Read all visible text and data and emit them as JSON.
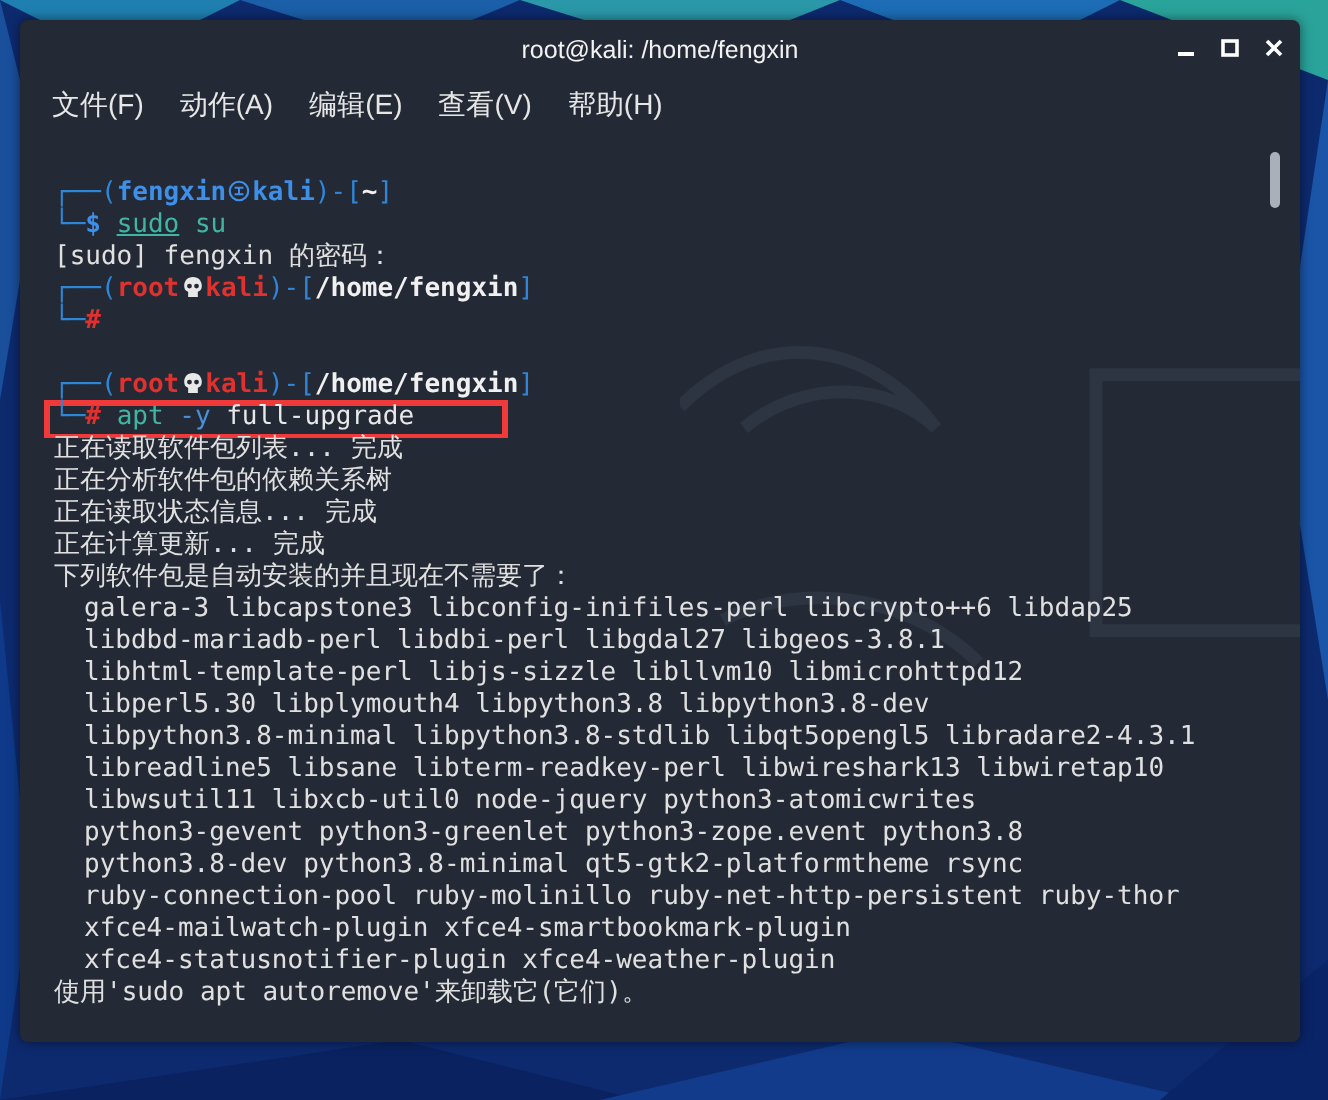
{
  "window": {
    "title": "root@kali: /home/fengxin"
  },
  "menu": [
    "文件(F)",
    "动作(A)",
    "编辑(E)",
    "查看(V)",
    "帮助(H)"
  ],
  "lines": [
    {
      "kind": "prompt",
      "root": false,
      "open": "┌──(",
      "user": "fengxin",
      "host": "kali",
      "middle": ")-[",
      "path": "~",
      "close": "]"
    },
    {
      "kind": "command",
      "root": false,
      "highlighted": false,
      "frame": "└─",
      "sigil": "$",
      "tokens": [
        {
          "kind": "precommand",
          "text": "sudo"
        },
        {
          "kind": "command",
          "text": "su"
        }
      ]
    },
    {
      "kind": "output",
      "text": "[sudo] fengxin 的密码："
    },
    {
      "kind": "prompt",
      "root": true,
      "open": "┌──(",
      "user": "root",
      "host": "kali",
      "middle": ")-[",
      "path": "/home/fengxin",
      "close": "]"
    },
    {
      "kind": "command",
      "root": true,
      "highlighted": false,
      "frame": "└─",
      "sigil": "#"
    },
    {
      "kind": "blank"
    },
    {
      "kind": "prompt",
      "root": true,
      "open": "┌──(",
      "user": "root",
      "host": "kali",
      "middle": ")-[",
      "path": "/home/fengxin",
      "close": "]"
    },
    {
      "kind": "command",
      "root": true,
      "highlighted": true,
      "frame": "└─",
      "sigil": "#",
      "tokens": [
        {
          "kind": "command",
          "text": "apt"
        },
        {
          "kind": "option",
          "text": "-y"
        },
        {
          "kind": "argument",
          "text": "full-upgrade"
        }
      ]
    },
    {
      "kind": "output",
      "text": "正在读取软件包列表... 完成"
    },
    {
      "kind": "output",
      "text": "正在分析软件包的依赖关系树"
    },
    {
      "kind": "output",
      "text": "正在读取状态信息... 完成"
    },
    {
      "kind": "output",
      "text": "正在计算更新... 完成"
    },
    {
      "kind": "output",
      "text": "下列软件包是自动安装的并且现在不需要了："
    },
    {
      "kind": "package",
      "text": "galera-3 libcapstone3 libconfig-inifiles-perl libcrypto++6 libdap25"
    },
    {
      "kind": "package",
      "text": "libdbd-mariadb-perl libdbi-perl libgdal27 libgeos-3.8.1"
    },
    {
      "kind": "package",
      "text": "libhtml-template-perl libjs-sizzle libllvm10 libmicrohttpd12"
    },
    {
      "kind": "package",
      "text": "libperl5.30 libplymouth4 libpython3.8 libpython3.8-dev"
    },
    {
      "kind": "package",
      "text": "libpython3.8-minimal libpython3.8-stdlib libqt5opengl5 libradare2-4.3.1"
    },
    {
      "kind": "package",
      "text": "libreadline5 libsane libterm-readkey-perl libwireshark13 libwiretap10"
    },
    {
      "kind": "package",
      "text": "libwsutil11 libxcb-util0 node-jquery python3-atomicwrites"
    },
    {
      "kind": "package",
      "text": "python3-gevent python3-greenlet python3-zope.event python3.8"
    },
    {
      "kind": "package",
      "text": "python3.8-dev python3.8-minimal qt5-gtk2-platformtheme rsync"
    },
    {
      "kind": "package",
      "text": "ruby-connection-pool ruby-molinillo ruby-net-http-persistent ruby-thor"
    },
    {
      "kind": "package",
      "text": "xfce4-mailwatch-plugin xfce4-smartbookmark-plugin"
    },
    {
      "kind": "package",
      "text": "xfce4-statusnotifier-plugin xfce4-weather-plugin"
    },
    {
      "kind": "output",
      "text": "使用'sudo apt autoremove'来卸载它(它们)。"
    }
  ]
}
